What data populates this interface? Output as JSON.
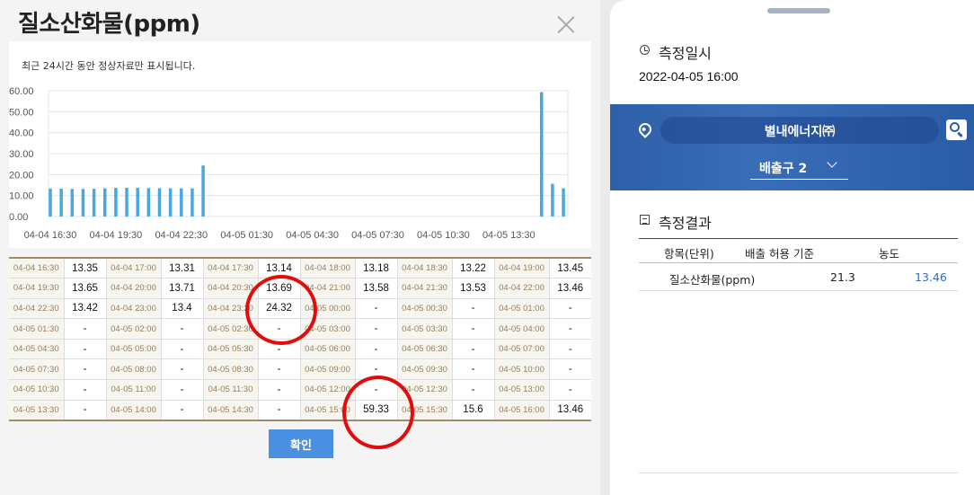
{
  "modal": {
    "title": "질소산화물(ppm)",
    "notice": "최근 24시간 동안 정상자료만 표시됩니다.",
    "confirm_label": "확인"
  },
  "chart_data": {
    "type": "bar",
    "ylim": [
      0,
      60
    ],
    "y_ticks": [
      "0.00",
      "10.00",
      "20.00",
      "30.00",
      "40.00",
      "50.00",
      "60.00"
    ],
    "x_tick_labels": [
      "04-04 16:30",
      "04-04 19:30",
      "04-04 22:30",
      "04-05 01:30",
      "04-05 04:30",
      "04-05 07:30",
      "04-05 10:30",
      "04-05 13:30"
    ],
    "categories": [
      "04-04 16:30",
      "04-04 17:00",
      "04-04 17:30",
      "04-04 18:00",
      "04-04 18:30",
      "04-04 19:00",
      "04-04 19:30",
      "04-04 20:00",
      "04-04 20:30",
      "04-04 21:00",
      "04-04 21:30",
      "04-04 22:00",
      "04-04 22:30",
      "04-04 23:00",
      "04-04 23:30",
      "04-05 00:00",
      "04-05 00:30",
      "04-05 01:00",
      "04-05 01:30",
      "04-05 02:00",
      "04-05 02:30",
      "04-05 03:00",
      "04-05 03:30",
      "04-05 04:00",
      "04-05 04:30",
      "04-05 05:00",
      "04-05 05:30",
      "04-05 06:00",
      "04-05 06:30",
      "04-05 07:00",
      "04-05 07:30",
      "04-05 08:00",
      "04-05 08:30",
      "04-05 09:00",
      "04-05 09:30",
      "04-05 10:00",
      "04-05 10:30",
      "04-05 11:00",
      "04-05 11:30",
      "04-05 12:00",
      "04-05 12:30",
      "04-05 13:00",
      "04-05 13:30",
      "04-05 14:00",
      "04-05 14:30",
      "04-05 15:00",
      "04-05 15:30",
      "04-05 16:00"
    ],
    "values": [
      13.35,
      13.31,
      13.14,
      13.18,
      13.22,
      13.45,
      13.65,
      13.71,
      13.69,
      13.58,
      13.53,
      13.46,
      13.42,
      13.4,
      24.32,
      null,
      null,
      null,
      null,
      null,
      null,
      null,
      null,
      null,
      null,
      null,
      null,
      null,
      null,
      null,
      null,
      null,
      null,
      null,
      null,
      null,
      null,
      null,
      null,
      null,
      null,
      null,
      null,
      null,
      null,
      59.33,
      15.6,
      13.46
    ],
    "bar_color": "#4aa8e0"
  },
  "table_rows": [
    [
      "04-04 16:30",
      "13.35",
      "04-04 17:00",
      "13.31",
      "04-04 17:30",
      "13.14",
      "04-04 18:00",
      "13.18",
      "04-04 18:30",
      "13.22",
      "04-04 19:00",
      "13.45"
    ],
    [
      "04-04 19:30",
      "13.65",
      "04-04 20:00",
      "13.71",
      "04-04 20:30",
      "13.69",
      "04-04 21:00",
      "13.58",
      "04-04 21:30",
      "13.53",
      "04-04 22:00",
      "13.46"
    ],
    [
      "04-04 22:30",
      "13.42",
      "04-04 23:00",
      "13.4",
      "04-04 23:30",
      "24.32",
      "04-05 00:00",
      "-",
      "04-05 00:30",
      "-",
      "04-05 01:00",
      "-"
    ],
    [
      "04-05 01:30",
      "-",
      "04-05 02:00",
      "-",
      "04-05 02:30",
      "-",
      "04-05 03:00",
      "-",
      "04-05 03:30",
      "-",
      "04-05 04:00",
      "-"
    ],
    [
      "04-05 04:30",
      "-",
      "04-05 05:00",
      "-",
      "04-05 05:30",
      "-",
      "04-05 06:00",
      "-",
      "04-05 06:30",
      "-",
      "04-05 07:00",
      "-"
    ],
    [
      "04-05 07:30",
      "-",
      "04-05 08:00",
      "-",
      "04-05 08:30",
      "-",
      "04-05 09:00",
      "-",
      "04-05 09:30",
      "-",
      "04-05 10:00",
      "-"
    ],
    [
      "04-05 10:30",
      "-",
      "04-05 11:00",
      "-",
      "04-05 11:30",
      "-",
      "04-05 12:00",
      "-",
      "04-05 12:30",
      "-",
      "04-05 13:00",
      "-"
    ],
    [
      "04-05 13:30",
      "-",
      "04-05 14:00",
      "-",
      "04-05 14:30",
      "-",
      "04-05 15:00",
      "59.33",
      "04-05 15:30",
      "15.6",
      "04-05 16:00",
      "13.46"
    ]
  ],
  "panel": {
    "time_label": "측정일시",
    "time_value": "2022-04-05 16:00",
    "site_name": "별내에너지㈜",
    "outlet": "배출구 2",
    "result_label": "측정결과",
    "result_headers": {
      "item": "항목(단위)",
      "limit": "배출 허용 기준",
      "conc": "농도"
    },
    "result_row": {
      "item": "질소산화물(ppm)",
      "limit": "21.3",
      "conc": "13.46"
    },
    "accent_color": "#2e6bc6"
  }
}
